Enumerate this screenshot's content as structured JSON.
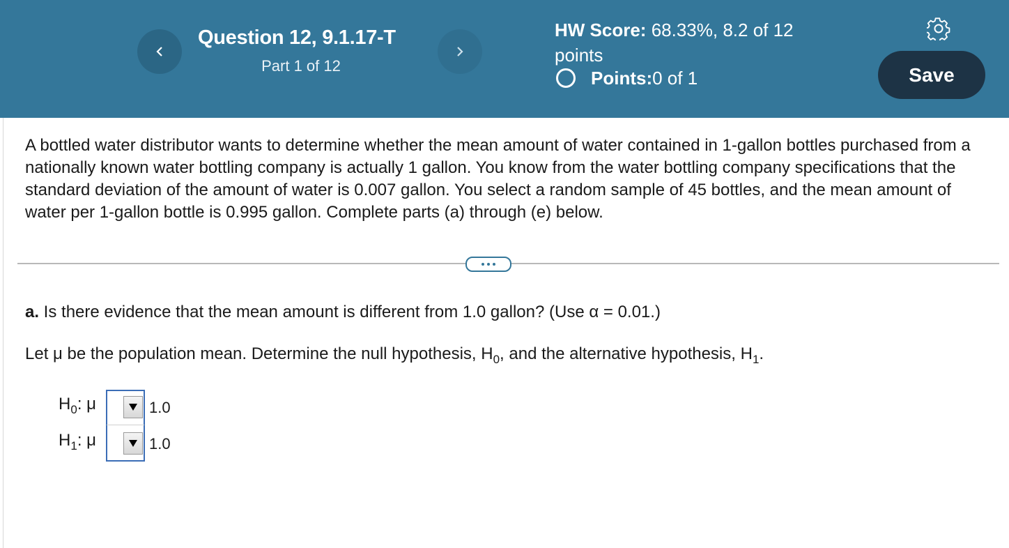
{
  "header": {
    "question_title": "Question 12, 9.1.17-T",
    "part_label": "Part 1 of 12",
    "hw_score_label": "HW Score:",
    "hw_score_value": " 68.33%, 8.2 of 12 points",
    "points_label": "Points:",
    "points_value": " 0 of 1",
    "save_label": "Save",
    "prev_icon": "chevron-left-icon",
    "next_icon": "chevron-right-icon",
    "settings_icon": "gear-icon",
    "accent_color": "#34779a",
    "save_color": "#1d3345"
  },
  "problem": {
    "text": "A bottled water distributor wants to determine whether the mean amount of water contained in 1-gallon bottles purchased from a nationally known water bottling company is actually 1 gallon. You know from the water bottling company specifications that the standard deviation of the amount of water is 0.007 gallon. You select a random sample of 45 bottles, and the mean amount of water per 1-gallon bottle is 0.995 gallon. Complete parts (a) through (e) below."
  },
  "part_a": {
    "prefix": "a.",
    "question": " Is there evidence that the mean amount is different from 1.0 gallon? (Use α = 0.01.)",
    "instruction_1": "Let μ be the population mean. Determine the null hypothesis, H",
    "instruction_sub0": "0",
    "instruction_2": ", and the alternative hypothesis, H",
    "instruction_sub1": "1",
    "instruction_3": "."
  },
  "hypotheses": [
    {
      "h": "H",
      "sub": "0",
      "mu": ": μ",
      "selected": "",
      "value": "1.0"
    },
    {
      "h": "H",
      "sub": "1",
      "mu": ": μ",
      "selected": "",
      "value": "1.0"
    }
  ]
}
